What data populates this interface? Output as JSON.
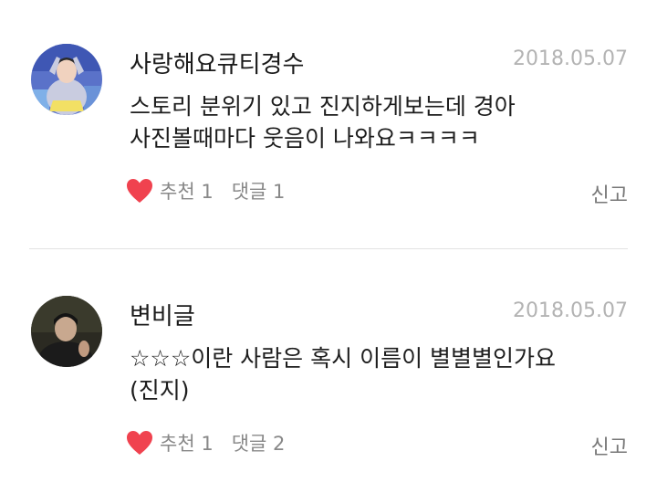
{
  "comments": [
    {
      "author": "사랑해요큐티경수",
      "date": "2018.05.07",
      "lines": [
        "스토리 분위기 있고 진지하게보는데 경아",
        "사진볼때마다 웃음이 나와요ㅋㅋㅋㅋ"
      ],
      "likes_label": "추천",
      "likes_count": "1",
      "replies_label": "댓글",
      "replies_count": "1",
      "report_label": "신고"
    },
    {
      "author": "변비글",
      "date": "2018.05.07",
      "lines": [
        "☆☆☆이란 사람은 혹시 이름이 별별별인가요",
        "(진지)"
      ],
      "likes_label": "추천",
      "likes_count": "1",
      "replies_label": "댓글",
      "replies_count": "2",
      "report_label": "신고"
    }
  ],
  "colors": {
    "heart": "#f0424f",
    "meta": "#b3b3b3",
    "divider": "#e2e2e2"
  },
  "icons": {
    "like": "heart-icon"
  }
}
